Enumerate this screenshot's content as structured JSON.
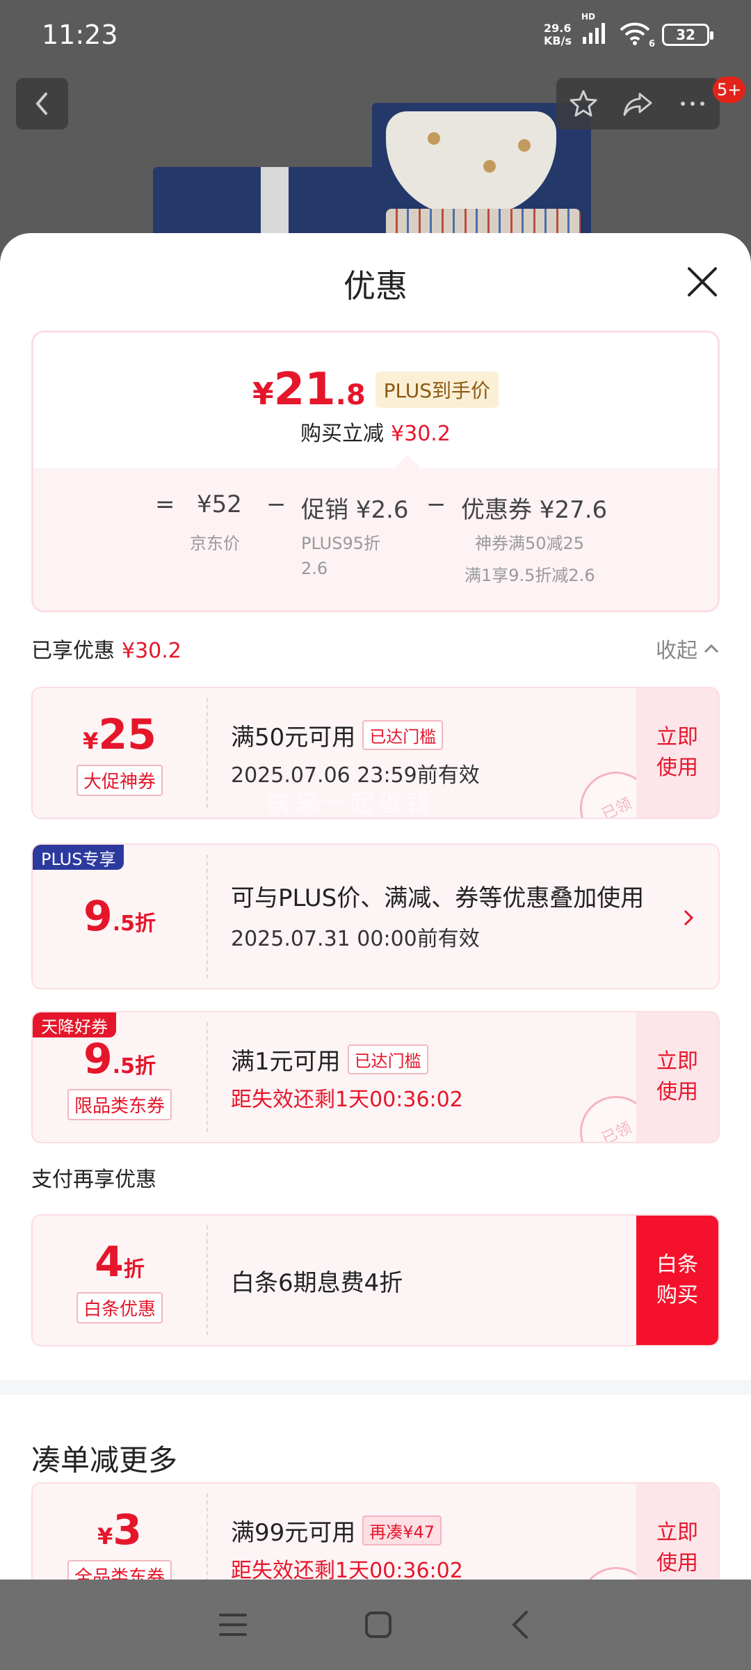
{
  "status_bar": {
    "time": "11:23",
    "net_speed_value": "29.6",
    "net_speed_unit": "KB/s",
    "hd_label": "HD",
    "wifi_label": "6",
    "battery": "32"
  },
  "top_nav": {
    "badge": "5+"
  },
  "sheet": {
    "title": "优惠",
    "summary": {
      "currency": "¥",
      "price_integer": "21",
      "price_decimal": ".8",
      "plus_tag": "PLUS到手价",
      "reduce_label": "购买立减",
      "reduce_value": "¥30.2",
      "equals": "=",
      "minus": "−",
      "jd_price": "¥52",
      "jd_price_label": "京东价",
      "promo": "促销 ¥2.6",
      "promo_sub_1": "PLUS95折",
      "promo_sub_2": "2.6",
      "coupon": "优惠券 ¥27.6",
      "coupon_sub_1": "神券满50减25",
      "coupon_sub_2": "满1享9.5折减2.6"
    },
    "enjoyed": {
      "label": "已享优惠",
      "value": "¥30.2",
      "collapse": "收起"
    },
    "coupons": [
      {
        "currency": "¥",
        "amount": "25",
        "type": "大促神券",
        "condition": "满50元可用",
        "tag": "已达门槛",
        "valid": "2025.07.06 23:59前有效",
        "action_1": "立即",
        "action_2": "使用",
        "stamp": "已领"
      },
      {
        "corner": "PLUS专享",
        "amount": "9",
        "amount_dec": ".5折",
        "condition": "可与PLUS价、满减、券等优惠叠加使用",
        "valid": "2025.07.31 00:00前有效"
      },
      {
        "corner": "天降好券",
        "amount": "9",
        "amount_dec": ".5折",
        "type": "限品类东券",
        "condition": "满1元可用",
        "tag": "已达门槛",
        "valid": "距失效还剩1天00:36:02",
        "action_1": "立即",
        "action_2": "使用",
        "stamp": "已领"
      }
    ],
    "watermark": "快来一起省钱",
    "pay_section": {
      "label": "支付再享优惠",
      "amount": "4",
      "amount_unit": "折",
      "type": "白条优惠",
      "condition": "白条6期息费4折",
      "action_1": "白条",
      "action_2": "购买"
    },
    "more_section": {
      "title": "凑单减更多",
      "currency": "¥",
      "amount": "3",
      "type": "全品类东券",
      "condition": "满99元可用",
      "tag": "再凑¥47",
      "valid": "距失效还剩1天00:36:02",
      "action_1": "立即",
      "action_2": "使用"
    }
  },
  "colors": {
    "accent_red": "#e5162b",
    "plus_blue": "#2c3a9e",
    "tianjiang_red": "#e5162b",
    "baitiao_button": "#f5112b"
  }
}
